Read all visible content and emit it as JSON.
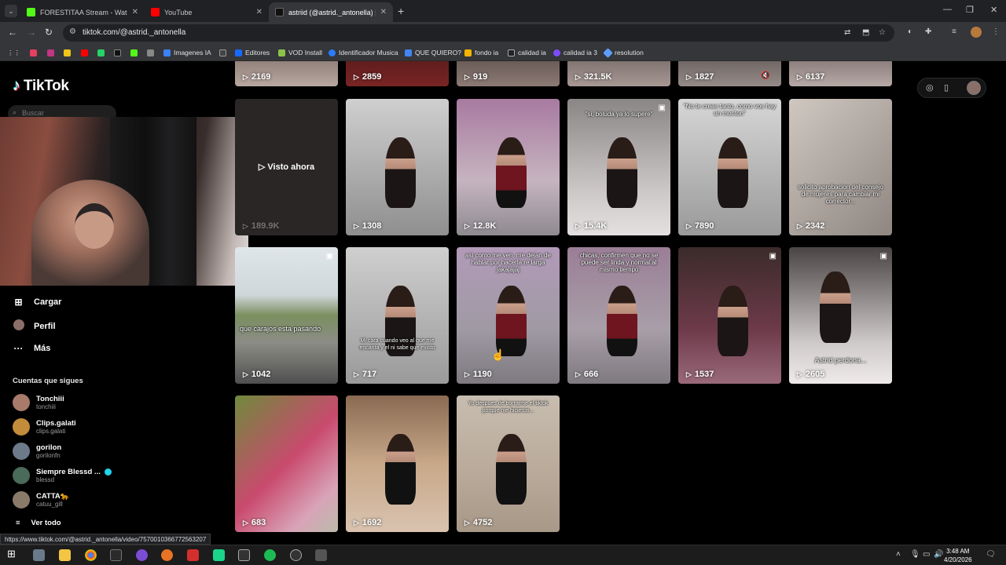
{
  "browser": {
    "tabs": [
      {
        "title": "FORESTITAA Stream - Watch Li...",
        "color": "#53fc18",
        "active": false
      },
      {
        "title": "YouTube",
        "color": "#ff0000",
        "active": false
      },
      {
        "title": "astriid (@astrid._antonella) | Ti...",
        "color": "#111111",
        "active": true
      }
    ],
    "url": "tiktok.com/@astrid._antonella",
    "bookmarks": [
      {
        "label": "",
        "color": "#e4405f"
      },
      {
        "label": "",
        "color": "#c13584"
      },
      {
        "label": "",
        "color": "#f0c419"
      },
      {
        "label": "",
        "color": "#ff0000"
      },
      {
        "label": "",
        "color": "#25d366"
      },
      {
        "label": "",
        "color": "#111111"
      },
      {
        "label": "",
        "color": "#53fc18"
      },
      {
        "label": "",
        "color": "#888888"
      },
      {
        "label": "Imagenes IA",
        "color": "#3b82f6"
      },
      {
        "label": "",
        "color": "#444444"
      },
      {
        "label": "Editores",
        "color": "#1769ff"
      },
      {
        "label": "VOD Install",
        "color": "#8bc34a"
      },
      {
        "label": "Identificador Musica",
        "color": "#2b7cff"
      },
      {
        "label": "QUE QUIERO?",
        "color": "#4285f4"
      },
      {
        "label": "fondo ia",
        "color": "#f4b400"
      },
      {
        "label": "calidad ia",
        "color": "#222222"
      },
      {
        "label": "calidad ia 3",
        "color": "#7c4dff"
      },
      {
        "label": "resolution",
        "color": "#5c9dff"
      }
    ],
    "status_url": "https://www.tiktok.com/@astrid._antonella/video/7570010366772563207"
  },
  "tiktok": {
    "logo_text": "TikTok",
    "search_placeholder": "Buscar",
    "nav": [
      {
        "label": "Cargar",
        "icon": "upload-icon"
      },
      {
        "label": "Perfil",
        "icon": "profile-icon"
      },
      {
        "label": "Más",
        "icon": "more-icon"
      }
    ],
    "following_title": "Cuentas que sigues",
    "following": [
      {
        "name": "Tonchiii",
        "user": "tonchiii",
        "color": "#a77a6a",
        "verified": false
      },
      {
        "name": "Clips.galati",
        "user": "clips.galati",
        "color": "#c28c3a",
        "verified": false
      },
      {
        "name": "gorilon",
        "user": "gorilonfn",
        "color": "#6c7a8a",
        "verified": false
      },
      {
        "name": "Siempre Blessd ...",
        "user": "blessd",
        "color": "#4a6a5a",
        "verified": true
      },
      {
        "name": "CATTA🐆",
        "user": "catuu_gill",
        "color": "#8a7a6a",
        "verified": false
      }
    ],
    "see_all": "Ver todo",
    "watched_label": "Visto ahora",
    "videos_top_row": [
      "2169",
      "2859",
      "919",
      "321.5K",
      "1827",
      "6137"
    ],
    "videos": [
      {
        "views": "189.9K",
        "caption": "",
        "watched": true
      },
      {
        "views": "1308",
        "caption": ""
      },
      {
        "views": "12.8K",
        "caption": ""
      },
      {
        "views": "15.4K",
        "caption": "\"si, boluda ya lo supere\""
      },
      {
        "views": "7890",
        "caption": "\"No te creas tanto, como vos hay un monton\""
      },
      {
        "views": "2342",
        "caption": "solicito aprobacion del consejo de mujeres para cambiar mi corrector..."
      },
      {
        "views": "1042",
        "caption": "que carajos esta pasando"
      },
      {
        "views": "717",
        "caption": "Mi cara cuando veo al que me encanta y el ni sabe que existo"
      },
      {
        "views": "1190",
        "caption": "asi como me ven, me dejan de hablar por hacerla re larga jakajajaj"
      },
      {
        "views": "666",
        "caption": "chicas, confirmen que no se puede ser linda y normal al mismo tiempo"
      },
      {
        "views": "1537",
        "caption": ""
      },
      {
        "views": "2605",
        "caption": "Astrid perdona..."
      },
      {
        "views": "683",
        "caption": ""
      },
      {
        "views": "1692",
        "caption": ""
      },
      {
        "views": "4752",
        "caption": "Yo despues de borrarme el tiktok porque me hicieron..."
      }
    ]
  },
  "taskbar": {
    "time": "3:48 AM",
    "date": "4/20/2026"
  }
}
